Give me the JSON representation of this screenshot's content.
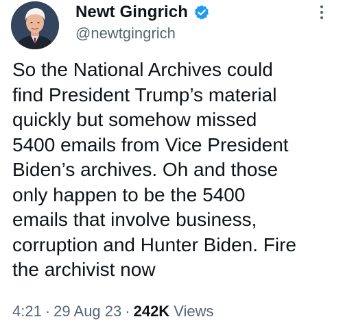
{
  "author": {
    "display_name": "Newt Gingrich",
    "handle": "@newtgingrich",
    "verified": true
  },
  "tweet": {
    "text": "So the National Archives could\nfind President Trump’s material\nquickly but somehow missed\n5400 emails from Vice President\nBiden’s archives. Oh and those\nonly happen to be the 5400\nemails that involve business,\ncorruption and Hunter Biden. Fire\nthe archivist now",
    "time": "4:21",
    "date": "29 Aug 23",
    "separator": "·",
    "views_count": "242K",
    "views_label": "Views"
  },
  "icons": {
    "verified": "verified-badge-icon",
    "more": "more-options-icon"
  },
  "colors": {
    "text_primary": "#0f1419",
    "text_secondary": "#536471",
    "verified_blue": "#1d9bf0"
  }
}
